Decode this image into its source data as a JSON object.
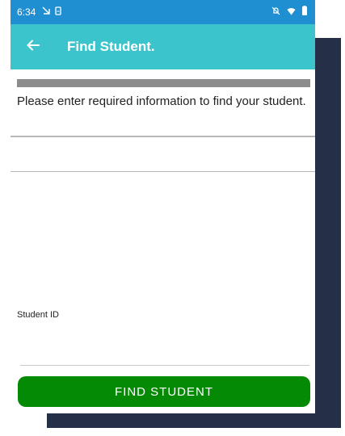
{
  "status_bar": {
    "time": "6:34",
    "left_icons": [
      "download-icon",
      "sim-icon"
    ],
    "right_icons": [
      "mute-icon",
      "wifi-icon",
      "battery-icon"
    ]
  },
  "app_bar": {
    "title": "Find Student.",
    "back_icon": "arrow-left-icon"
  },
  "content": {
    "instructions": "Please enter required information to find your student."
  },
  "form": {
    "student_id_label": "Student ID",
    "student_id_value": ""
  },
  "actions": {
    "find_label": "FIND STUDENT"
  },
  "colors": {
    "status_bar": "#1f8fd1",
    "app_bar": "#3cc4cc",
    "button": "#058a05",
    "backdrop": "#252f48"
  }
}
